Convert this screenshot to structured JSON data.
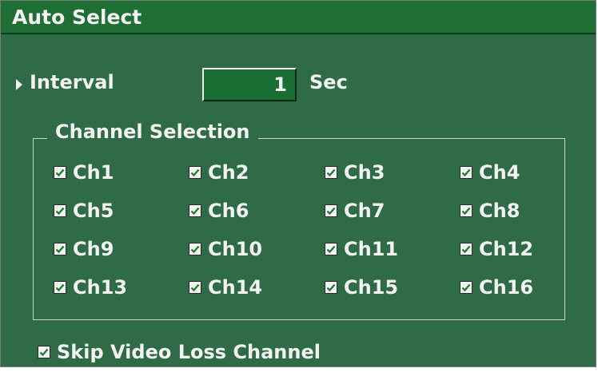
{
  "dialog": {
    "title": "Auto Select",
    "interval_label": "Interval",
    "interval_value": "1",
    "interval_unit": "Sec",
    "channel_group_label": "Channel Selection",
    "channels": [
      {
        "label": "Ch1",
        "checked": true
      },
      {
        "label": "Ch2",
        "checked": true
      },
      {
        "label": "Ch3",
        "checked": true
      },
      {
        "label": "Ch4",
        "checked": true
      },
      {
        "label": "Ch5",
        "checked": true
      },
      {
        "label": "Ch6",
        "checked": true
      },
      {
        "label": "Ch7",
        "checked": true
      },
      {
        "label": "Ch8",
        "checked": true
      },
      {
        "label": "Ch9",
        "checked": true
      },
      {
        "label": "Ch10",
        "checked": true
      },
      {
        "label": "Ch11",
        "checked": true
      },
      {
        "label": "Ch12",
        "checked": true
      },
      {
        "label": "Ch13",
        "checked": true
      },
      {
        "label": "Ch14",
        "checked": true
      },
      {
        "label": "Ch15",
        "checked": true
      },
      {
        "label": "Ch16",
        "checked": true
      }
    ],
    "skip_video_loss_label": "Skip Video Loss Channel",
    "skip_video_loss_checked": true
  },
  "colors": {
    "panel": "#2e6b46",
    "title_bar": "#1f6e34",
    "check_mark": "#1a7a2a"
  }
}
